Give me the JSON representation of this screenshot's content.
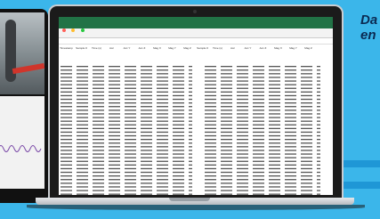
{
  "promo": {
    "line1": "Da",
    "line2": "en"
  },
  "spreadsheet": {
    "title_cells": [
      "Timestamp",
      "Sample #",
      "Time (s)",
      "Acc",
      "Acc Y",
      "Acc Z",
      "Mag X",
      "Mag Y",
      "Mag Z",
      "Sample #",
      "Time (s)",
      "Acc",
      "Acc Y",
      "Acc Z",
      "Mag X",
      "Mag Y",
      "Mag Z"
    ]
  },
  "colors": {
    "background": "#3bb6ea",
    "excel_green": "#217346",
    "promo_text": "#0b2a52"
  }
}
